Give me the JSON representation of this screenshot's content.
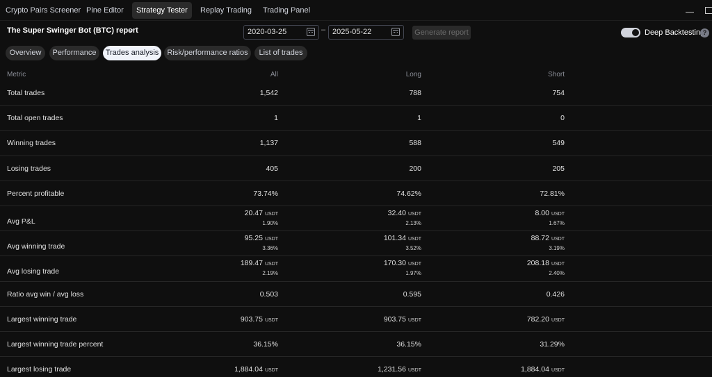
{
  "top_tabs": [
    "Crypto Pairs Screener",
    "Pine Editor",
    "Strategy Tester",
    "Replay Trading",
    "Trading Panel"
  ],
  "active_top_tab": "Strategy Tester",
  "report": {
    "title": "The Super Swinger Bot (BTC) report",
    "date_from": "2020-03-25",
    "date_to": "2025-05-22",
    "date_separator": "–",
    "generate_label": "Generate report",
    "deep_backtesting_label": "Deep Backtesting",
    "deep_backtesting_on": true,
    "help_glyph": "?"
  },
  "sub_tabs": [
    "Overview",
    "Performance",
    "Trades analysis",
    "Risk/performance ratios",
    "List of trades"
  ],
  "active_sub_tab": "Trades analysis",
  "table": {
    "headers": {
      "metric": "Metric",
      "all": "All",
      "long": "Long",
      "short": "Short"
    },
    "rows": [
      {
        "label": "Total trades",
        "all": "1,542",
        "long": "788",
        "short": "754"
      },
      {
        "label": "Total open trades",
        "all": "1",
        "long": "1",
        "short": "0"
      },
      {
        "label": "Winning trades",
        "all": "1,137",
        "long": "588",
        "short": "549"
      },
      {
        "label": "Losing trades",
        "all": "405",
        "long": "200",
        "short": "205"
      },
      {
        "label": "Percent profitable",
        "all": "73.74%",
        "long": "74.62%",
        "short": "72.81%"
      },
      {
        "label": "Avg P&L",
        "all": "20.47",
        "long": "32.40",
        "short": "8.00",
        "unit": "USDT",
        "all_sub": "1.90%",
        "long_sub": "2.13%",
        "short_sub": "1.67%"
      },
      {
        "label": "Avg winning trade",
        "all": "95.25",
        "long": "101.34",
        "short": "88.72",
        "unit": "USDT",
        "all_sub": "3.36%",
        "long_sub": "3.52%",
        "short_sub": "3.19%"
      },
      {
        "label": "Avg losing trade",
        "all": "189.47",
        "long": "170.30",
        "short": "208.18",
        "unit": "USDT",
        "all_sub": "2.19%",
        "long_sub": "1.97%",
        "short_sub": "2.40%"
      },
      {
        "label": "Ratio avg win / avg loss",
        "all": "0.503",
        "long": "0.595",
        "short": "0.426"
      },
      {
        "label": "Largest winning trade",
        "all": "903.75",
        "long": "903.75",
        "short": "782.20",
        "unit": "USDT"
      },
      {
        "label": "Largest winning trade percent",
        "all": "36.15%",
        "long": "36.15%",
        "short": "31.29%"
      },
      {
        "label": "Largest losing trade",
        "all": "1,884.04",
        "long": "1,231.56",
        "short": "1,884.04",
        "unit": "USDT"
      }
    ]
  },
  "colors": {
    "background": "#0f0f0f",
    "text": "#d1d4dc",
    "muted": "#8a8d96",
    "active_pill": "#f0f3fa"
  }
}
